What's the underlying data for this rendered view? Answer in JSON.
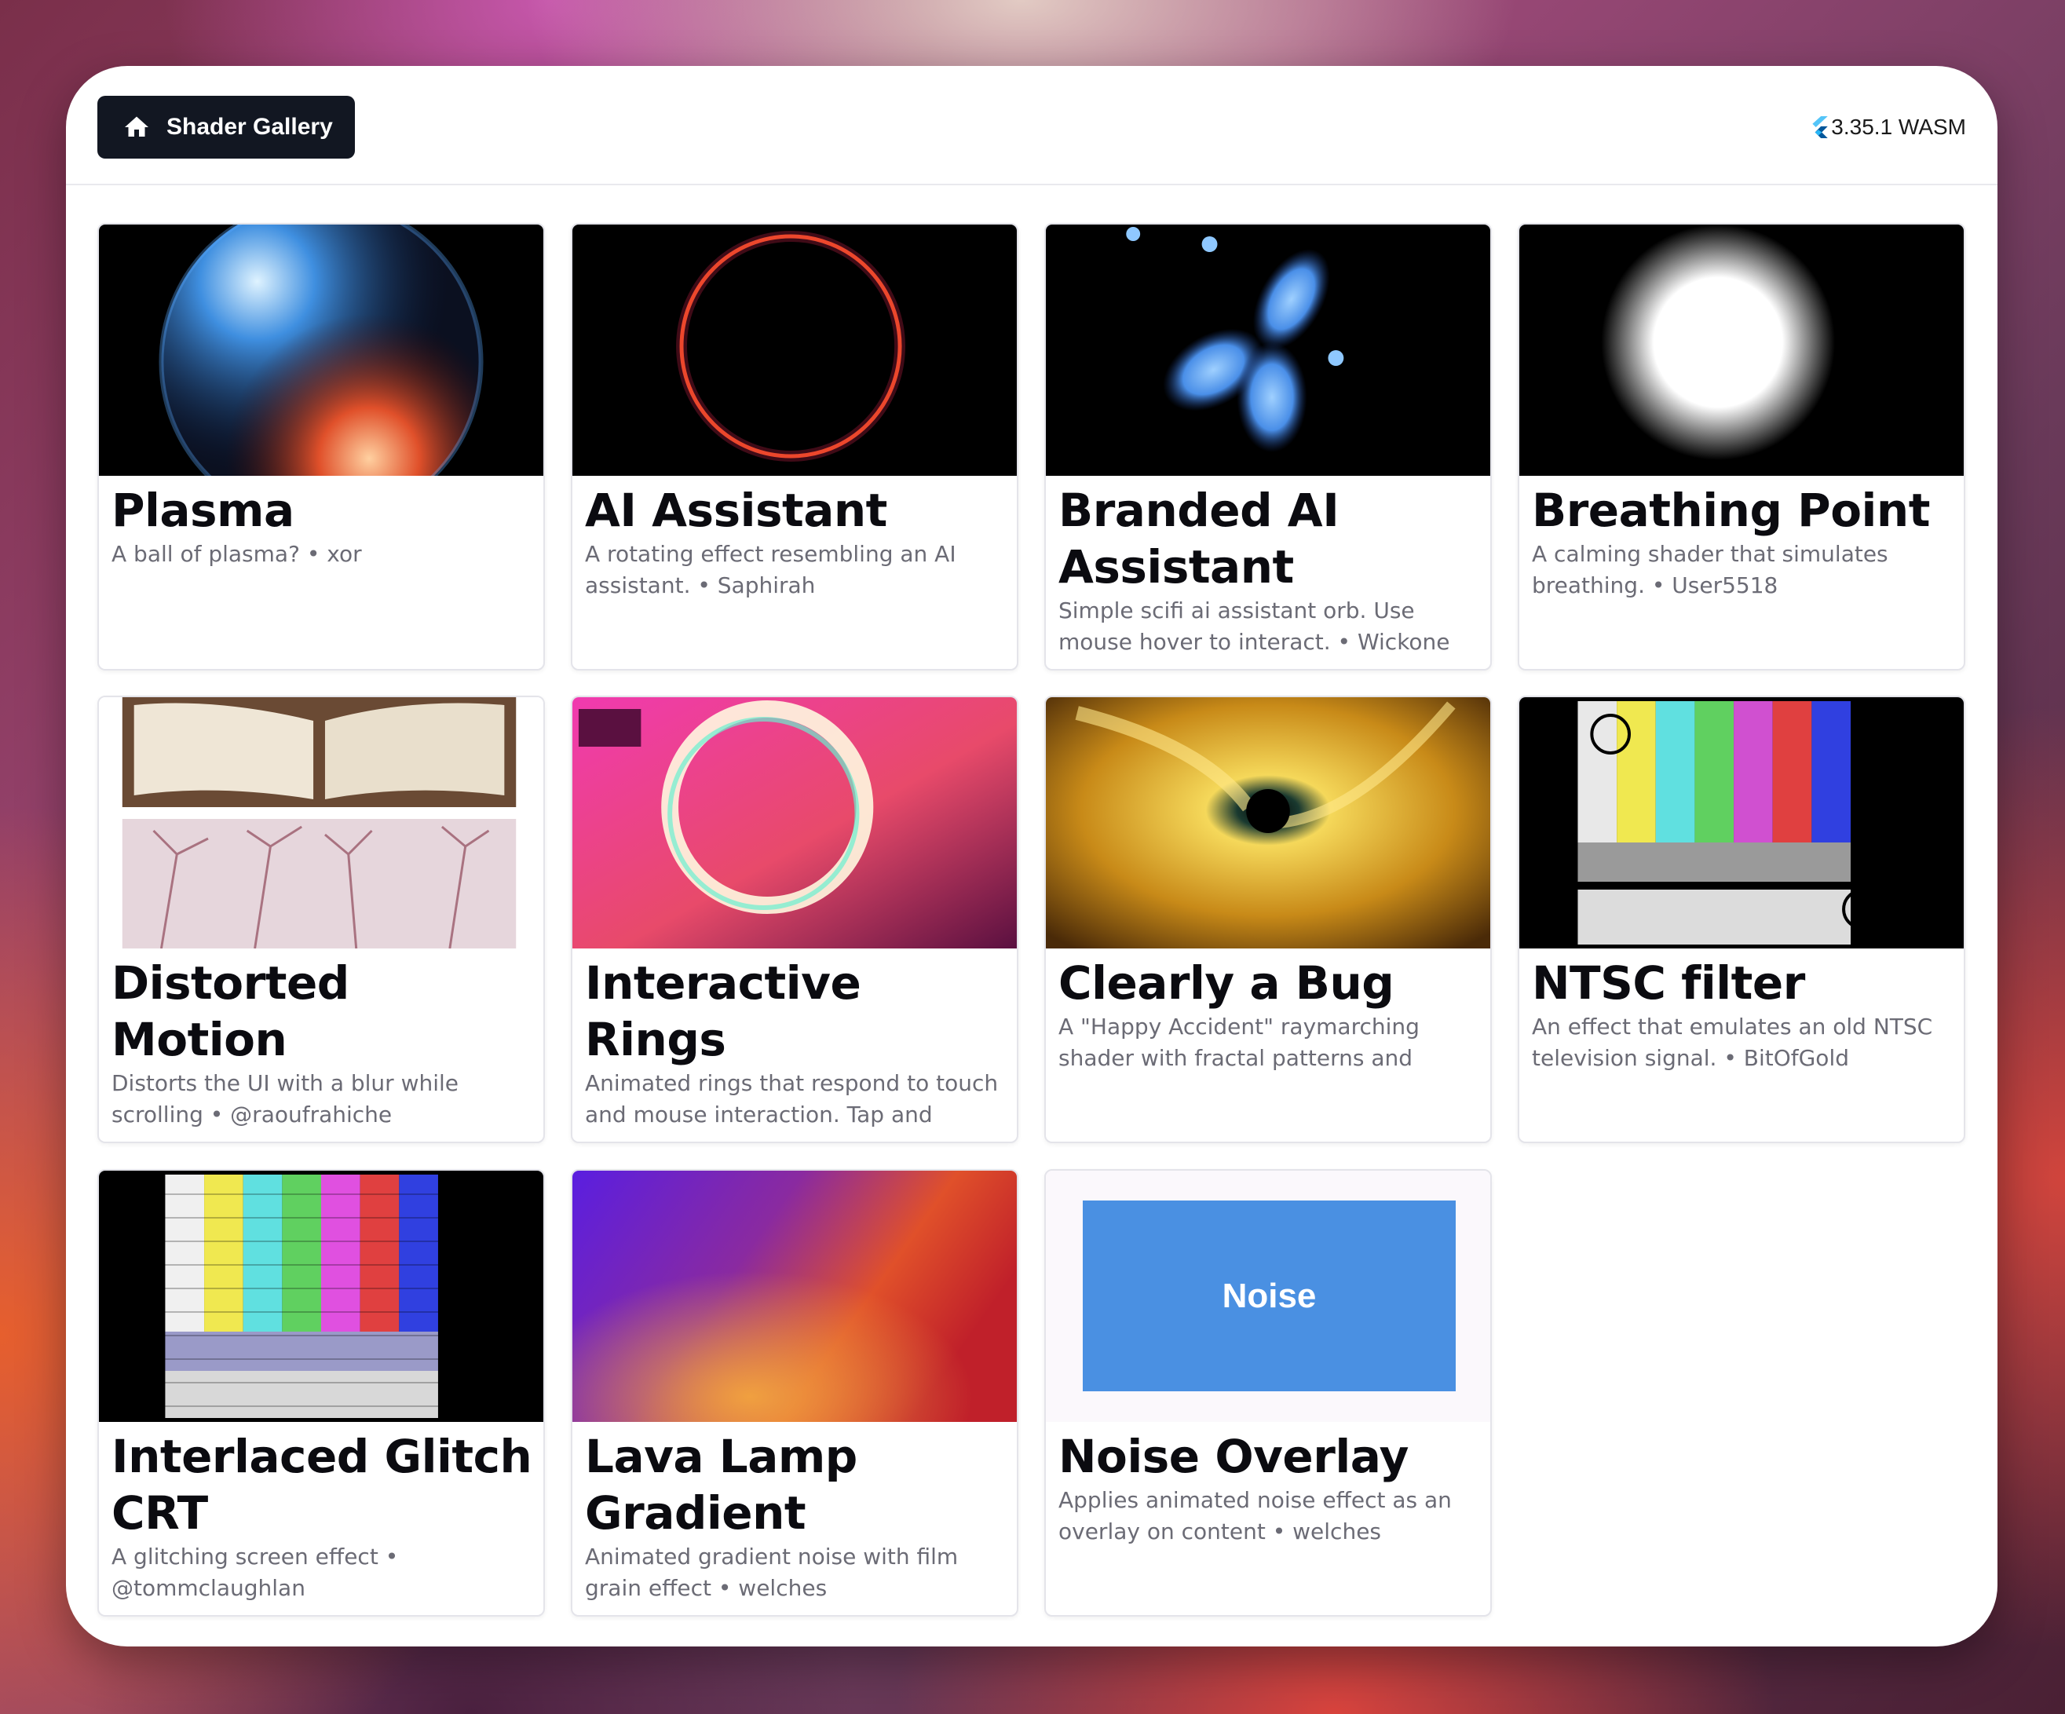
{
  "header": {
    "home_label": "Shader Gallery",
    "home_icon": "home-icon",
    "version_icon": "flutter-icon",
    "version": "3.35.1 WASM"
  },
  "cards": [
    {
      "title": "Plasma",
      "description": "A ball of plasma? • xor"
    },
    {
      "title": "AI Assistant",
      "description": "A rotating effect resembling an AI assistant. • Saphirah"
    },
    {
      "title": "Branded AI Assistant",
      "description": "Simple scifi ai assistant orb. Use mouse hover to interact. • Wickone"
    },
    {
      "title": "Breathing Point",
      "description": "A calming shader that simulates breathing. • User5518"
    },
    {
      "title": "Distorted Motion",
      "description": "Distorts the UI with a blur while scrolling • @raoufrahiche"
    },
    {
      "title": "Interactive Rings",
      "description": "Animated rings that respond to touch and mouse interaction. Tap and"
    },
    {
      "title": "Clearly a Bug",
      "description": "A \"Happy Accident\" raymarching shader with fractal patterns and"
    },
    {
      "title": "NTSC filter",
      "description": "An effect that emulates an old NTSC television signal. • BitOfGold"
    },
    {
      "title": "Interlaced Glitch CRT",
      "description": "A glitching screen effect • @tommclaughlan"
    },
    {
      "title": "Lava Lamp Gradient",
      "description": "Animated gradient noise with film grain effect • welches"
    },
    {
      "title": "Noise Overlay",
      "description": "Applies animated noise effect as an overlay on content • welches",
      "preview_label": "Noise"
    }
  ],
  "colors": {
    "header_button_bg": "#121722",
    "noise_preview": "#4a90e2"
  }
}
